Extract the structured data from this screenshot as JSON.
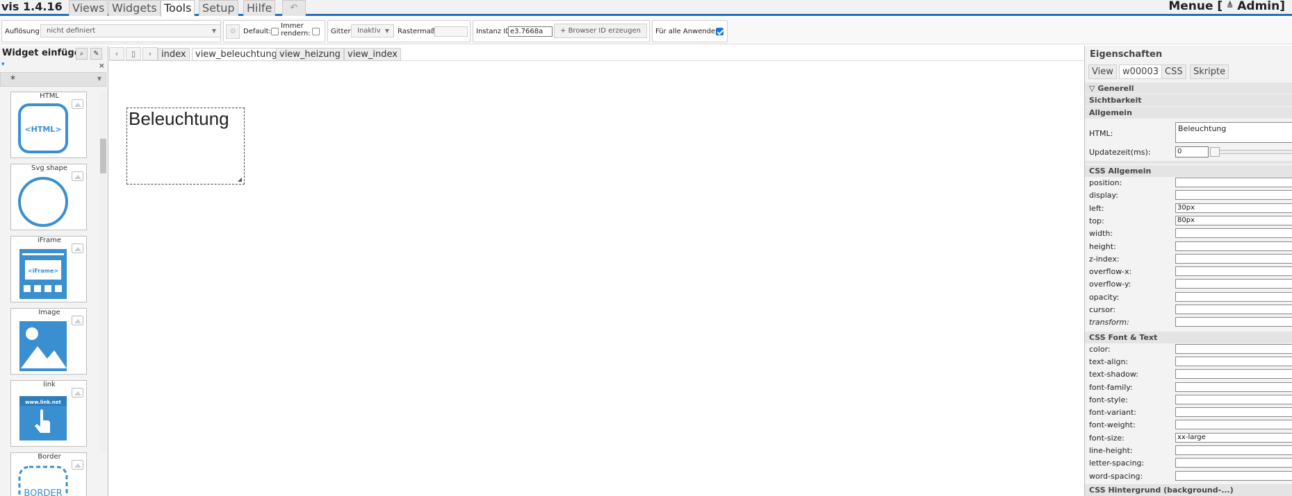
{
  "menubar": {
    "app_title": "vis 1.4.16",
    "tabs": [
      "Views",
      "Widgets",
      "Tools",
      "Setup",
      "Hilfe"
    ],
    "active_tab": "Tools",
    "undo_glyph": "↶",
    "menu_label": "Menue [",
    "user_glyph": "≜",
    "user_name": "Admin]"
  },
  "toolbar": {
    "resolution_label": "Auflösung:",
    "resolution_value": "nicht definiert",
    "default_label": "Default:",
    "always_render_label_1": "Immer",
    "always_render_label_2": "rendern:",
    "grid_label": "Gitter",
    "grid_value": "Inaktiv",
    "raster_label": "Rastermaß:",
    "instance_label": "Instanz ID",
    "instance_value": "e3.7668a",
    "browser_id_button": "Browser ID erzeugen",
    "all_users_label": "Für alle Anwender:",
    "all_users_checked": true
  },
  "left_panel": {
    "title": "Widget einfügen",
    "filter_value": "*",
    "close_glyph": "×",
    "widgets": [
      {
        "name": "HTML",
        "art_text": "<HTML>"
      },
      {
        "name": "Svg shape",
        "art_text": ""
      },
      {
        "name": "iFrame",
        "art_text": "<iFrame>"
      },
      {
        "name": "Image",
        "art_text": ""
      },
      {
        "name": "link",
        "art_text": "www.link.net"
      },
      {
        "name": "Border",
        "art_text": "BORDER"
      }
    ]
  },
  "view_tabs": {
    "tabs": [
      "index",
      "view_beleuchtung",
      "view_heizung",
      "view_index"
    ],
    "active": "view_beleuchtung"
  },
  "canvas": {
    "widget_text": "Beleuchtung"
  },
  "properties": {
    "title": "Eigenschaften",
    "tabs": [
      "View",
      "w00003",
      "CSS",
      "Skripte"
    ],
    "active_tab": "w00003",
    "general_label": "Generell",
    "visibility_label": "Sichtbarkeit",
    "allgemein_label": "Allgemein",
    "html_label": "HTML:",
    "html_value": "Beleuchtung",
    "update_label": "Updatezeit(ms):",
    "update_value": "0",
    "css_general_label": "CSS Allgemein",
    "css_general_rows": [
      {
        "label": "position:",
        "value": ""
      },
      {
        "label": "display:",
        "value": ""
      },
      {
        "label": "left:",
        "value": "30px"
      },
      {
        "label": "top:",
        "value": "80px"
      },
      {
        "label": "width:",
        "value": ""
      },
      {
        "label": "height:",
        "value": ""
      },
      {
        "label": "z-index:",
        "value": ""
      },
      {
        "label": "overflow-x:",
        "value": ""
      },
      {
        "label": "overflow-y:",
        "value": ""
      },
      {
        "label": "opacity:",
        "value": ""
      },
      {
        "label": "cursor:",
        "value": ""
      },
      {
        "label": "transform:",
        "value": ""
      }
    ],
    "css_font_label": "CSS Font & Text",
    "css_font_rows": [
      {
        "label": "color:",
        "value": ""
      },
      {
        "label": "text-align:",
        "value": ""
      },
      {
        "label": "text-shadow:",
        "value": ""
      },
      {
        "label": "font-family:",
        "value": ""
      },
      {
        "label": "font-style:",
        "value": ""
      },
      {
        "label": "font-variant:",
        "value": ""
      },
      {
        "label": "font-weight:",
        "value": ""
      },
      {
        "label": "font-size:",
        "value": "xx-large"
      },
      {
        "label": "line-height:",
        "value": ""
      },
      {
        "label": "letter-spacing:",
        "value": ""
      },
      {
        "label": "word-spacing:",
        "value": ""
      }
    ],
    "css_bg_label": "CSS Hintergrund (background-...)"
  },
  "colors": {
    "accent": "#1f6fbf",
    "widget_icon": "#3a8fd0"
  }
}
